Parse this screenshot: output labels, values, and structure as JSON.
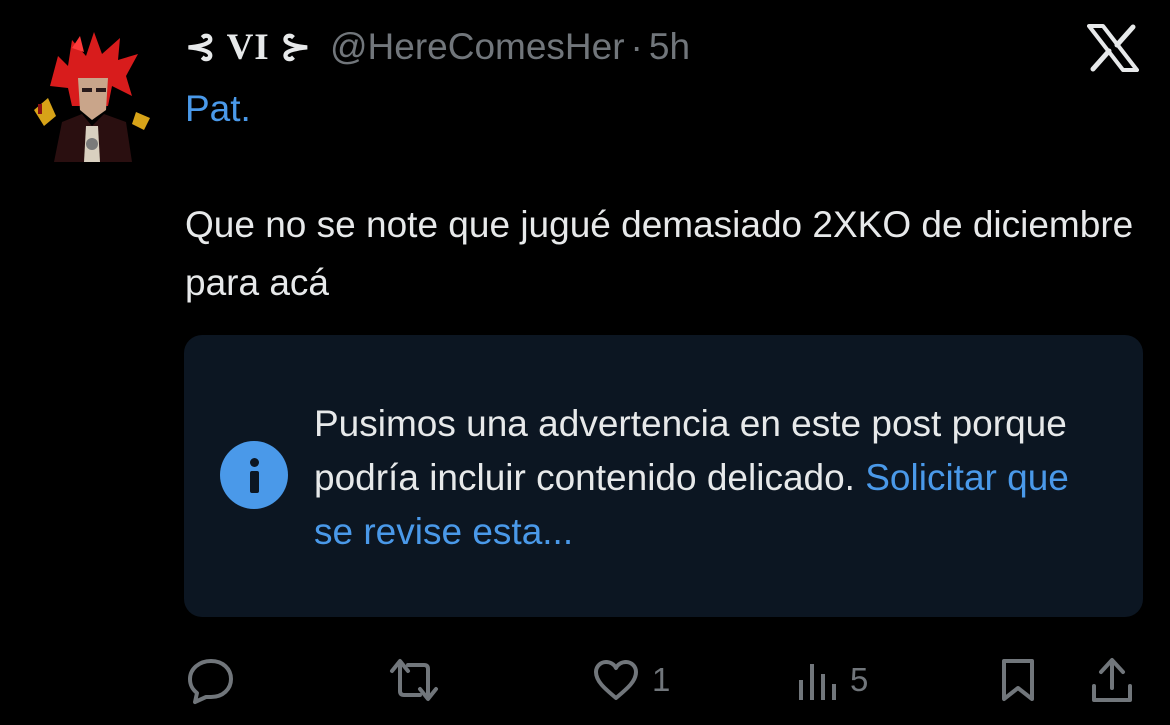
{
  "author": {
    "display_name": "⊰ VI ⊱",
    "handle": "@HereComesHer",
    "separator": "·",
    "time": "5h",
    "avatar_alt": "red-haired-character-avatar"
  },
  "post": {
    "mention": "Pat.",
    "text": "Que no se note que jugué demasiado 2XKO de diciembre para acá"
  },
  "warning": {
    "message": "Pusimos una advertencia en este post porque podría incluir contenido delicado.",
    "link": "Solicitar que se revise esta..."
  },
  "actions": {
    "reply": {
      "icon": "reply-icon",
      "count": ""
    },
    "repost": {
      "icon": "repost-icon",
      "count": ""
    },
    "like": {
      "icon": "heart-icon",
      "count": "1"
    },
    "views": {
      "icon": "views-icon",
      "count": "5"
    },
    "bookmark": {
      "icon": "bookmark-icon"
    },
    "share": {
      "icon": "share-icon"
    }
  },
  "colors": {
    "background": "#000000",
    "text": "#e7e9ea",
    "muted": "#71767b",
    "accent": "#4a99e9",
    "warning_bg": "#0c1622"
  }
}
